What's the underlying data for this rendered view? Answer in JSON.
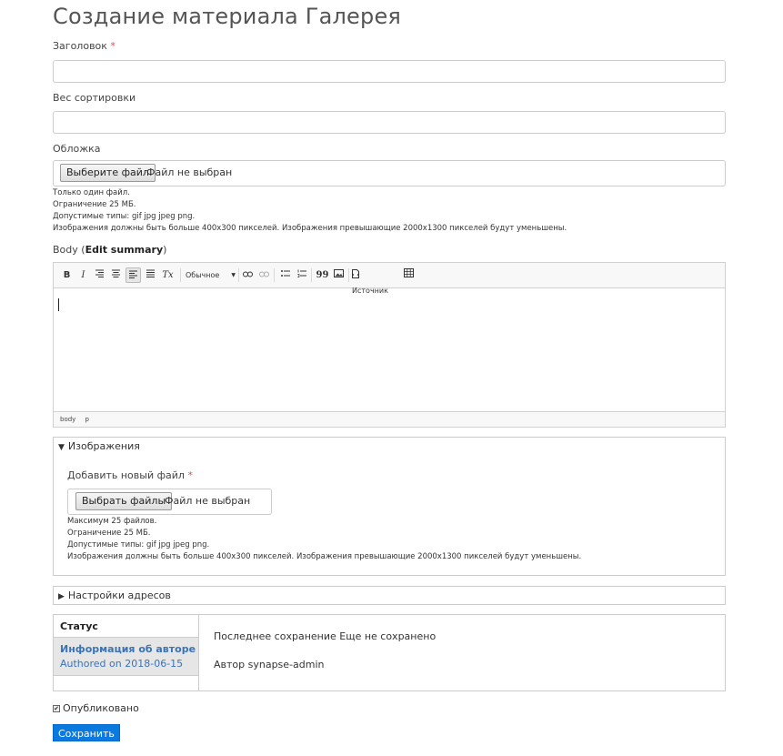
{
  "page": {
    "title": "Создание материала Галерея"
  },
  "fields": {
    "title": {
      "label": "Заголовок",
      "required": "*",
      "value": ""
    },
    "weight": {
      "label": "Вес сортировки",
      "value": ""
    },
    "cover": {
      "label": "Обложка",
      "button": "Выберите файл",
      "status": "Файл не выбран",
      "hints": [
        "Только один файл.",
        "Ограничение 25 МБ.",
        "Допустимые типы: gif jpg jpeg png.",
        "Изображения должны быть больше 400x300 пикселей. Изображения превышающие 2000x1300 пикселей будут уменьшены."
      ]
    },
    "body": {
      "label_prefix": "Body (",
      "edit_summary": "Edit summary",
      "label_suffix": ")",
      "format_select": "Обычное",
      "source_label": "Источник",
      "path": [
        "body",
        "p"
      ],
      "toolbar_glyphs": {
        "bold": "B",
        "italic": "I",
        "clear_format": "Tx",
        "blockquote": "99"
      }
    }
  },
  "images": {
    "summary": "Изображения",
    "add_label": "Добавить новый файл",
    "required": "*",
    "button": "Выбрать файлы",
    "status": "Файл не выбран",
    "hints": [
      "Максимум 25 файлов.",
      "Ограничение 25 МБ.",
      "Допустимые типы: gif jpg jpeg png.",
      "Изображения должны быть больше 400x300 пикселей. Изображения превышающие 2000x1300 пикселей будут уменьшены."
    ]
  },
  "url_settings": {
    "summary": "Настройки адресов"
  },
  "vertical_tabs": {
    "status": "Статус",
    "author_title": "Информация об авторе",
    "author_summary": "Authored on 2018-06-15",
    "last_saved": "Последнее сохранение Еще не сохранено",
    "author": "Автор synapse-admin"
  },
  "published": {
    "label": "Опубликовано",
    "checked": true
  },
  "actions": {
    "save": "Сохранить"
  }
}
